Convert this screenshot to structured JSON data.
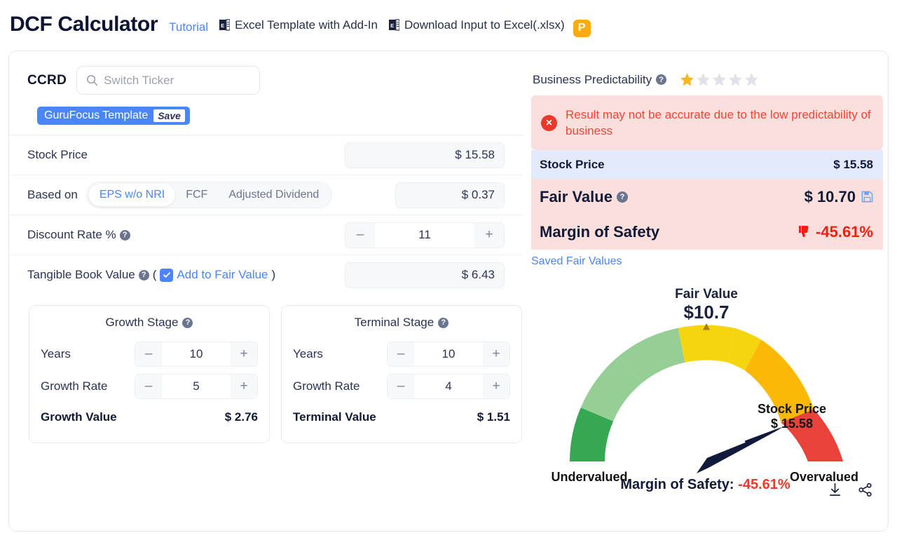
{
  "header": {
    "title": "DCF Calculator",
    "tutorial_label": "Tutorial",
    "excel_template_label": "Excel Template with Add-In",
    "download_input_label": "Download Input to Excel(.xlsx)",
    "pro_badge": "P",
    "excel_icon": "excel-file-icon"
  },
  "left": {
    "ticker": "CCRD",
    "search_placeholder": "Switch Ticker",
    "search_icon": "search-icon",
    "template_label": "GuruFocus Template",
    "template_save_label": "Save",
    "stock_price_label": "Stock Price",
    "stock_price_value": "$ 15.58",
    "based_on_label": "Based on",
    "based_on_options": [
      "EPS w/o NRI",
      "FCF",
      "Adjusted Dividend"
    ],
    "based_on_selected": "EPS w/o NRI",
    "based_on_value": "$ 0.37",
    "discount_rate_label": "Discount Rate %",
    "discount_rate_value": "11",
    "tangible_book_label": "Tangible Book Value",
    "tangible_book_paren_open": "(",
    "tangible_book_paren_close": ")",
    "add_to_fair_value_label": "Add to Fair Value",
    "add_to_fair_value_checked": true,
    "tangible_book_value": "$ 6.43",
    "minus_label": "–",
    "plus_label": "+",
    "help_label": "?",
    "growth_stage": {
      "title": "Growth Stage",
      "years_label": "Years",
      "years_value": "10",
      "rate_label": "Growth Rate",
      "rate_value": "5",
      "total_label": "Growth Value",
      "total_value": "$ 2.76"
    },
    "terminal_stage": {
      "title": "Terminal Stage",
      "years_label": "Years",
      "years_value": "10",
      "rate_label": "Growth Rate",
      "rate_value": "4",
      "total_label": "Terminal Value",
      "total_value": "$ 1.51"
    }
  },
  "right": {
    "predictability_label": "Business Predictability",
    "predictability_stars_filled": 1,
    "predictability_stars_total": 5,
    "warning_icon": "error-circle-icon",
    "warning_text": "Result may not be accurate due to the low predictability of business",
    "stock_price_label": "Stock Price",
    "stock_price_value": "$ 15.58",
    "fair_value_label": "Fair Value",
    "fair_value_value": "$ 10.70",
    "save_icon": "floppy-disk-save-icon",
    "margin_of_safety_label": "Margin of Safety",
    "margin_of_safety_value": "-45.61%",
    "thumbs_down_icon": "thumbs-down-icon",
    "saved_fair_values_label": "Saved Fair Values",
    "download_icon": "download-icon",
    "share_icon": "share-icon"
  },
  "chart_data": {
    "type": "gauge",
    "title": "Fair Value",
    "value_label": "$10.7",
    "fair_value": 10.7,
    "stock_price": 15.58,
    "stock_price_label": "Stock Price",
    "stock_price_value_label": "$ 15.58",
    "left_axis_label": "Undervalued",
    "right_axis_label": "Overvalued",
    "caption_label": "Margin of Safety:",
    "caption_value": "-45.61%",
    "needle_angle_deg": 155,
    "marker_angle_deg": 90,
    "segments": [
      {
        "name": "deep-undervalued",
        "color": "#36a852",
        "start_deg": 180,
        "end_deg": 144
      },
      {
        "name": "undervalued",
        "color": "#96cf96",
        "start_deg": 144,
        "end_deg": 108
      },
      {
        "name": "fair",
        "color": "#f5d510",
        "start_deg": 108,
        "end_deg": 72
      },
      {
        "name": "overvalued",
        "color": "#fbb905",
        "start_deg": 72,
        "end_deg": 36
      },
      {
        "name": "deep-overvalued",
        "color": "#e8423a",
        "start_deg": 36,
        "end_deg": 0
      }
    ]
  }
}
